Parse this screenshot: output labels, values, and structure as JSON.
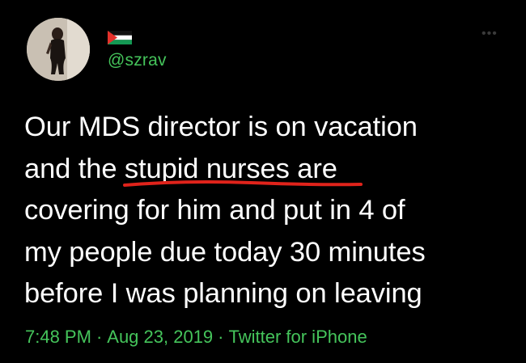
{
  "tweet": {
    "flag_icon": "palestine-flag-icon",
    "handle": "@szrav",
    "more_icon": "more-options-icon",
    "body": "Our MDS director is on vacation\nand the stupid nurses are\ncovering for him and put in 4 of\nmy people due today 30 minutes\nbefore I was planning on leaving",
    "underlined_phrase": "stupid nurses",
    "time": "7:48 PM",
    "separator": "·",
    "date": "Aug 23, 2019",
    "source": "Twitter for iPhone"
  },
  "colors": {
    "background": "#000000",
    "text": "#ffffff",
    "accent_green": "#45c45b",
    "annotation_red": "#e0231b"
  }
}
